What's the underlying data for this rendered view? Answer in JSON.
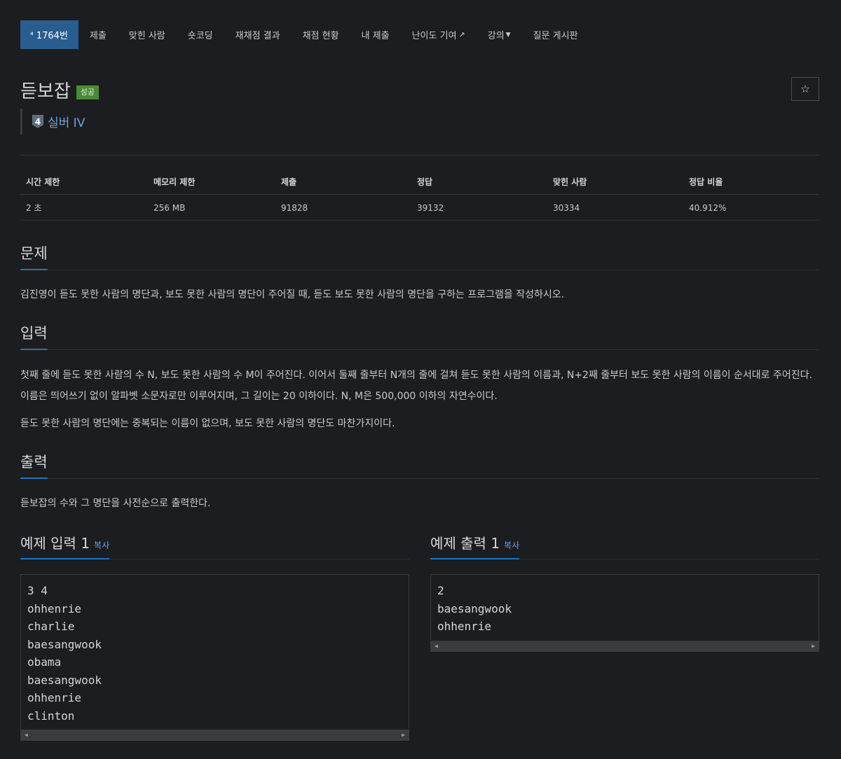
{
  "nav": {
    "items": [
      {
        "label": "1764번",
        "icon": "tier-icon",
        "active": true
      },
      {
        "label": "제출"
      },
      {
        "label": "맞힌 사람"
      },
      {
        "label": "숏코딩"
      },
      {
        "label": "재채점 결과"
      },
      {
        "label": "채점 현황"
      },
      {
        "label": "내 제출"
      },
      {
        "label": "난이도 기여",
        "icon": "external-link-icon"
      },
      {
        "label": "강의",
        "icon": "caret-down-icon"
      },
      {
        "label": "질문 게시판"
      }
    ]
  },
  "problem": {
    "title": "듣보잡",
    "status_badge": "성공",
    "tier_number": "4",
    "tier_label": "실버 IV",
    "star_icon": "☆"
  },
  "info": {
    "headers": [
      "시간 제한",
      "메모리 제한",
      "제출",
      "정답",
      "맞힌 사람",
      "정답 비율"
    ],
    "values": [
      "2 초",
      "256 MB",
      "91828",
      "39132",
      "30334",
      "40.912%"
    ]
  },
  "sections": {
    "problem_heading": "문제",
    "problem_text": "김진영이 듣도 못한 사람의 명단과, 보도 못한 사람의 명단이 주어질 때, 듣도 보도 못한 사람의 명단을 구하는 프로그램을 작성하시오.",
    "input_heading": "입력",
    "input_text_1": "첫째 줄에 듣도 못한 사람의 수 N, 보도 못한 사람의 수 M이 주어진다. 이어서 둘째 줄부터 N개의 줄에 걸쳐 듣도 못한 사람의 이름과, N+2째 줄부터 보도 못한 사람의 이름이 순서대로 주어진다. 이름은 띄어쓰기 없이 알파벳 소문자로만 이루어지며, 그 길이는 20 이하이다. N, M은 500,000 이하의 자연수이다.",
    "input_text_2": "듣도 못한 사람의 명단에는 중복되는 이름이 없으며, 보도 못한 사람의 명단도 마찬가지이다.",
    "output_heading": "출력",
    "output_text": "듣보잡의 수와 그 명단을 사전순으로 출력한다."
  },
  "samples": {
    "input_heading": "예제 입력 1",
    "output_heading": "예제 출력 1",
    "copy_label": "복사",
    "input_lines": [
      "3 4",
      "ohhenrie",
      "charlie",
      "baesangwook",
      "obama",
      "baesangwook",
      "ohhenrie",
      "clinton"
    ],
    "output_lines": [
      "2",
      "baesangwook",
      "ohhenrie"
    ]
  },
  "colors": {
    "background": "#1c1d20",
    "active_nav": "#2a5d8f",
    "success_badge": "#4a8a37",
    "link_blue": "#6ea4dd",
    "heading_underline": "#2a6fb0"
  }
}
